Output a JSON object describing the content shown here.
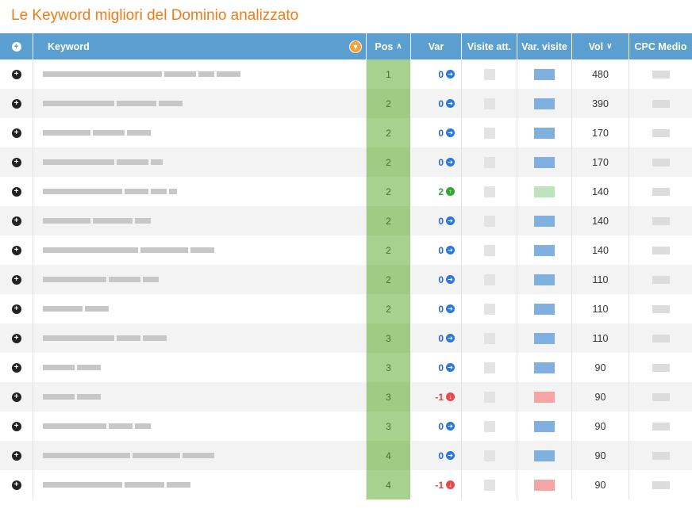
{
  "title": "Le Keyword migliori del Dominio analizzato",
  "headers": {
    "keyword": "Keyword",
    "pos": "Pos",
    "var": "Var",
    "visite_att": "Visite att.",
    "var_visite": "Var. visite",
    "vol": "Vol",
    "cpc": "CPC Medio"
  },
  "rows": [
    {
      "pos": "1",
      "var": "0",
      "trend": "zero",
      "vol": "480"
    },
    {
      "pos": "2",
      "var": "0",
      "trend": "zero",
      "vol": "390"
    },
    {
      "pos": "2",
      "var": "0",
      "trend": "zero",
      "vol": "170"
    },
    {
      "pos": "2",
      "var": "0",
      "trend": "zero",
      "vol": "170"
    },
    {
      "pos": "2",
      "var": "2",
      "trend": "up",
      "vol": "140"
    },
    {
      "pos": "2",
      "var": "0",
      "trend": "zero",
      "vol": "140"
    },
    {
      "pos": "2",
      "var": "0",
      "trend": "zero",
      "vol": "140"
    },
    {
      "pos": "2",
      "var": "0",
      "trend": "zero",
      "vol": "110"
    },
    {
      "pos": "2",
      "var": "0",
      "trend": "zero",
      "vol": "110"
    },
    {
      "pos": "3",
      "var": "0",
      "trend": "zero",
      "vol": "110"
    },
    {
      "pos": "3",
      "var": "0",
      "trend": "zero",
      "vol": "90"
    },
    {
      "pos": "3",
      "var": "-1",
      "trend": "down",
      "vol": "90"
    },
    {
      "pos": "3",
      "var": "0",
      "trend": "zero",
      "vol": "90"
    },
    {
      "pos": "4",
      "var": "0",
      "trend": "zero",
      "vol": "90"
    },
    {
      "pos": "4",
      "var": "-1",
      "trend": "down",
      "vol": "90"
    }
  ],
  "colors": {
    "title": "#f07b16",
    "header_bg": "#5a9fcf",
    "pos_bg": "#a6d18e",
    "var_zero": "#2a6cc4",
    "var_up": "#3aa13a",
    "var_down": "#e04545"
  }
}
